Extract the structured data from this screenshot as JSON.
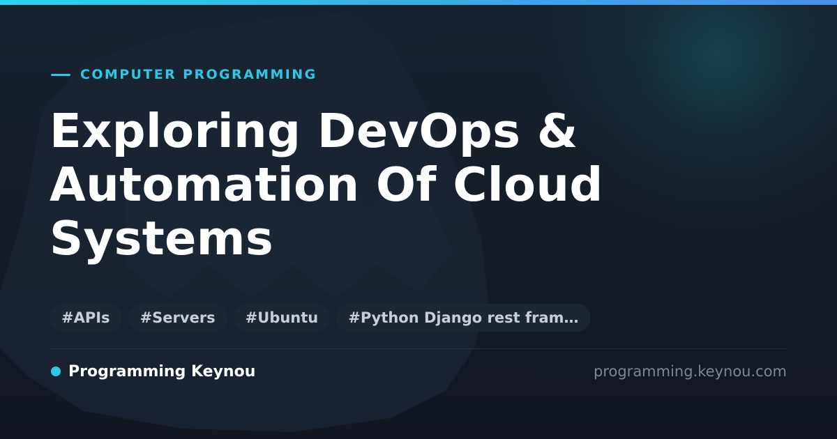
{
  "colors": {
    "accent": "#2bc9e6",
    "background": "#151c27",
    "title": "#ffffff",
    "tag_background": "#1c2734",
    "tag_text": "#c7ced8",
    "muted_text": "#7c8794"
  },
  "category": {
    "label": "COMPUTER PROGRAMMING"
  },
  "title": {
    "line1": "Exploring DevOps &",
    "line2": "Automation Of Cloud",
    "line3": "Systems"
  },
  "tags": [
    "#APIs",
    "#Servers",
    "#Ubuntu",
    "#Python Django rest fram…"
  ],
  "footer": {
    "brand_name": "Programming Keynou",
    "site_url": "programming.keynou.com"
  }
}
